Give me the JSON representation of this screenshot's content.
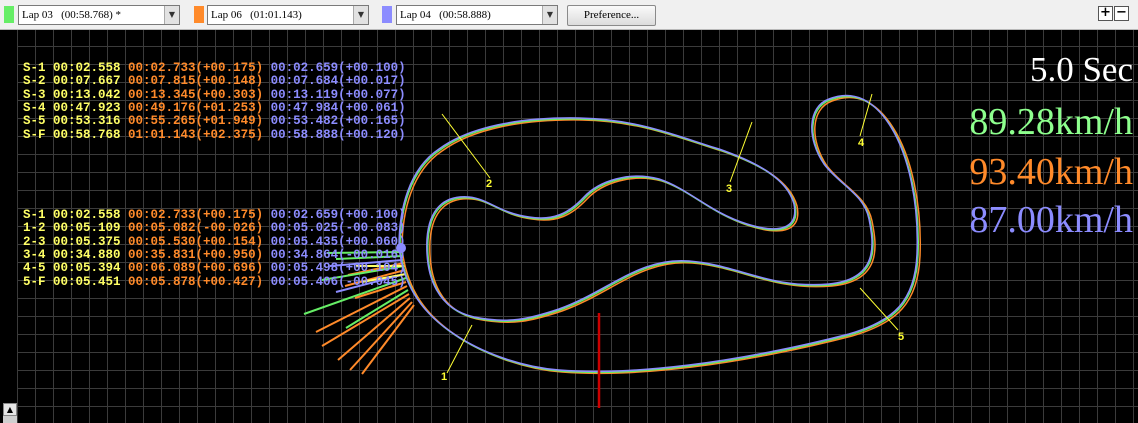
{
  "toolbar": {
    "laps": [
      {
        "label": "Lap 03   (00:58.768) *",
        "color": "#66ee66"
      },
      {
        "label": "Lap 06   (01:01.143)",
        "color": "#ff8a2a"
      },
      {
        "label": "Lap 04   (00:58.888)",
        "color": "#8c8cff"
      }
    ],
    "preference_label": "Preference...",
    "zoom_in_label": "+",
    "zoom_out_label": "−"
  },
  "section_times": [
    [
      "S-1 00:02.558",
      "00:02.733(+00.175)",
      "00:02.659(+00.100)"
    ],
    [
      "S-2 00:07.667",
      "00:07.815(+00.148)",
      "00:07.684(+00.017)"
    ],
    [
      "S-3 00:13.042",
      "00:13.345(+00.303)",
      "00:13.119(+00.077)"
    ],
    [
      "S-4 00:47.923",
      "00:49.176(+01.253)",
      "00:47.984(+00.061)"
    ],
    [
      "S-5 00:53.316",
      "00:55.265(+01.949)",
      "00:53.482(+00.165)"
    ],
    [
      "S-F 00:58.768",
      "01:01.143(+02.375)",
      "00:58.888(+00.120)"
    ]
  ],
  "split_times": [
    [
      "S-1 00:02.558",
      "00:02.733(+00.175)",
      "00:02.659(+00.100)"
    ],
    [
      "1-2 00:05.109",
      "00:05.082(-00.026)",
      "00:05.025(-00.083)"
    ],
    [
      "2-3 00:05.375",
      "00:05.530(+00.154)",
      "00:05.435(+00.060)"
    ],
    [
      "3-4 00:34.880",
      "00:35.831(+00.950)",
      "00:34.864(-00.016)"
    ],
    [
      "4-5 00:05.394",
      "00:06.089(+00.696)",
      "00:05.498(+00.104)"
    ],
    [
      "5-F 00:05.451",
      "00:05.878(+00.427)",
      "00:05.406(-00.045)"
    ]
  ],
  "stats": {
    "time": "5.0 Sec",
    "speeds": [
      "89.28km/h",
      "93.40km/h",
      "87.00km/h"
    ]
  },
  "track": {
    "sector_labels": [
      "1",
      "2",
      "3",
      "4",
      "5"
    ],
    "colors": {
      "line_a": "#66ee66",
      "line_b": "#ff8a2a",
      "line_c": "#8c8cff",
      "sector_marker": "#ffff33",
      "finish_line": "#cc0000"
    }
  }
}
